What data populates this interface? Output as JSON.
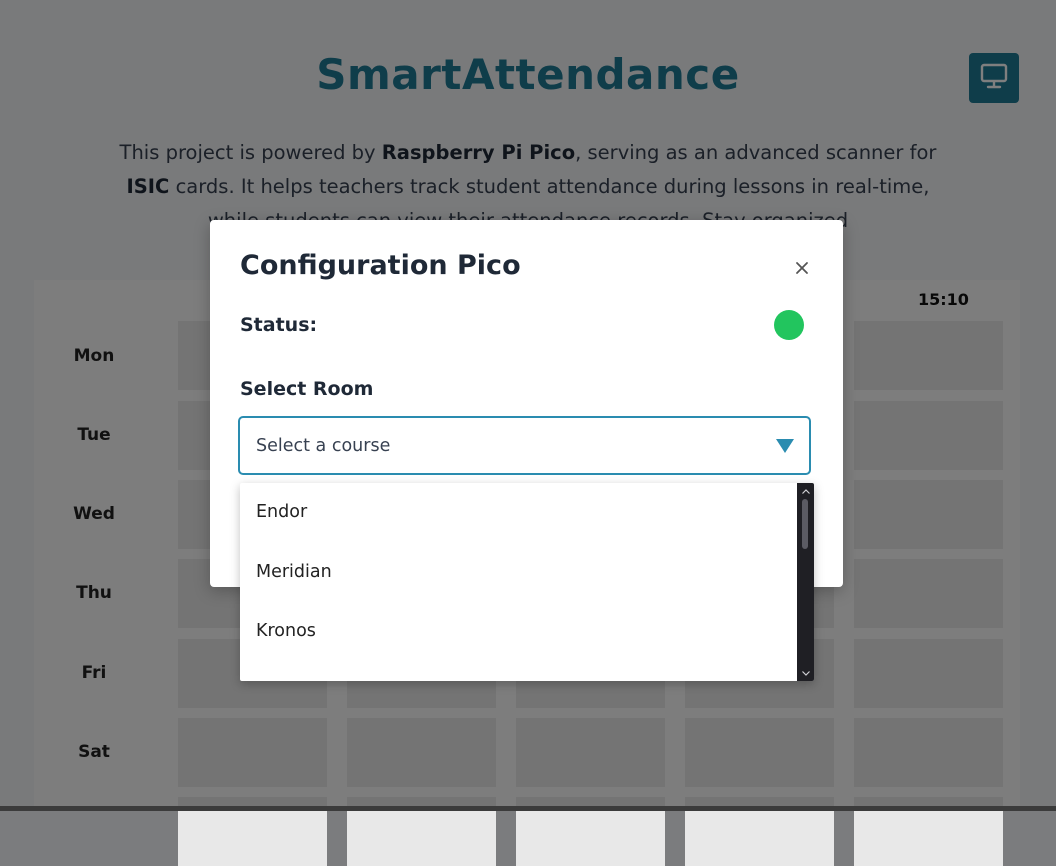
{
  "app": {
    "title": "SmartAttendance",
    "intro": {
      "part1": "This project is powered by ",
      "bold1": "Raspberry Pi Pico",
      "part2": ", serving as an advanced scanner for ",
      "bold2": "ISIC",
      "part3": " cards. It helps teachers track student attendance during lessons in real-time, while students can view their attendance records. Stay organized"
    },
    "display_button_icon": "monitor-icon",
    "accent_color": "#1f7a95"
  },
  "timetable": {
    "header_times": [
      "15:10"
    ],
    "days": [
      "Mon",
      "Tue",
      "Wed",
      "Thu",
      "Fri",
      "Sat"
    ]
  },
  "modal": {
    "title": "Configuration Pico",
    "close_icon": "close-icon",
    "status_label": "Status:",
    "status_color": "#22c55e",
    "room_label": "Select Room",
    "select": {
      "placeholder": "Select a course",
      "options": [
        "Endor",
        "Meridian",
        "Kronos"
      ]
    }
  }
}
